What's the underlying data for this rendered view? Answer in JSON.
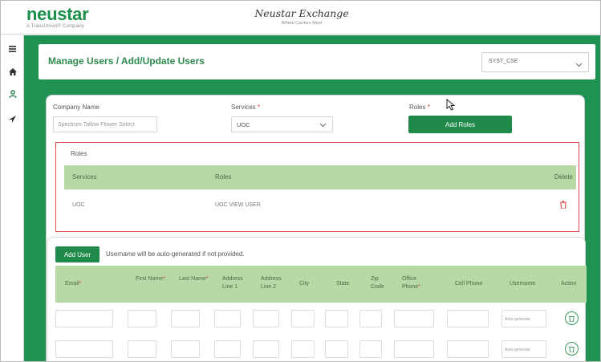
{
  "app": {
    "logo": "neustar",
    "logo_subtitle": "A TransUnion® Company",
    "title": "Neustar Exchange",
    "title_sub": "Where Carriers Meet"
  },
  "sidebar": {
    "icons": [
      "menu-icon",
      "home-icon",
      "users-icon",
      "send-icon"
    ]
  },
  "header": {
    "title": "Manage Users / Add/Update Users",
    "select_value": "SYST_CSE"
  },
  "form": {
    "company_label": "Company Name",
    "company_placeholder": "Spectrum Tallow Flower Select",
    "services_label": "Services",
    "services_value": "UOC",
    "roles_label": "Roles",
    "add_roles_button": "Add Roles"
  },
  "roles": {
    "section_label": "Roles",
    "columns": [
      "Services",
      "Roles",
      "Delete"
    ],
    "rows": [
      {
        "service": "UOC",
        "role": "UOC VIEW USER"
      }
    ]
  },
  "users": {
    "add_user_button": "Add User",
    "note": "Username will be auto-generated if not provided.",
    "columns": [
      {
        "label": "Email",
        "required": true
      },
      {
        "label": "First Name",
        "required": true
      },
      {
        "label": "Last Name",
        "required": true
      },
      {
        "label": "Address Line 1",
        "required": false
      },
      {
        "label": "Address Line 2",
        "required": false
      },
      {
        "label": "City",
        "required": false
      },
      {
        "label": "State",
        "required": false
      },
      {
        "label": "Zip Code",
        "required": false
      },
      {
        "label": "Office Phone",
        "required": true
      },
      {
        "label": "Cell Phone",
        "required": false
      },
      {
        "label": "Username",
        "required": false
      },
      {
        "label": "Action",
        "required": false
      }
    ],
    "username_placeholder": "Auto-generate",
    "row_count": 2
  },
  "colors": {
    "brand_green": "#1f9150",
    "table_header": "#b7d9a6",
    "highlight_red": "#d94c4c",
    "required_red": "#e03b3b"
  }
}
